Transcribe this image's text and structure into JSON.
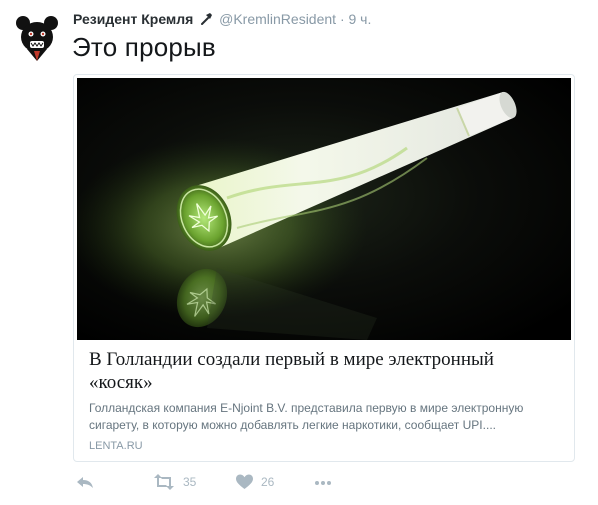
{
  "tweet": {
    "author_name": "Резидент Кремля",
    "author_handle": "@KremlinResident",
    "separator": "·",
    "time": "9 ч.",
    "text": "Это прорыв"
  },
  "card": {
    "title": "В Голландии создали первый в мире электронный «косяк»",
    "description": "Голландская компания E-Njoint B.V. представила первую в мире электронную сигарету, в которую можно добавлять легкие наркотики, сообщает UPI....",
    "domain": "LENTA.RU"
  },
  "actions": {
    "retweet_count": "35",
    "like_count": "26"
  },
  "colors": {
    "text": "#14171a",
    "muted": "#8899a6",
    "action_icon": "#aab8c2",
    "card_border": "#e1e8ed",
    "glow_green": "#b8f070"
  },
  "icons": [
    "bear-avatar-icon",
    "hammer-icon",
    "reply-icon",
    "retweet-icon",
    "heart-icon",
    "more-icon",
    "cannabis-leaf-icon"
  ]
}
